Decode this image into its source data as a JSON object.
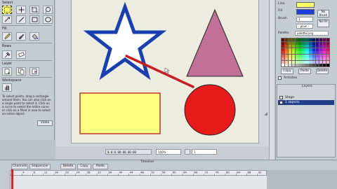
{
  "left_panel": {
    "sections": {
      "select": "Select",
      "fill": "Fill",
      "rows": "Rows",
      "layer": "Layer",
      "workspace": "Workspace"
    },
    "workspace_description": "To select points, drag a rectangle around them. You can also click on a single point to select it. Click on a curve to select the entire curve or click on a filled in area to select an entire object.",
    "video_button": "Video",
    "tools": [
      "select-tool",
      "move-tool",
      "crop-tool",
      "lasso-tool",
      "pen-tool",
      "line-tool",
      "rect-tool",
      "ellipse-tool",
      "pencil-tool",
      "brush-tool",
      "fill-tool",
      "eyedropper-tool",
      "eraser-tool",
      "layer-new",
      "layer-copy",
      "layer-delete",
      "hand-tool"
    ]
  },
  "stage": {
    "shapes": [
      {
        "kind": "star",
        "fill": "#ffffff",
        "stroke": "#1a3fb0"
      },
      {
        "kind": "triangle",
        "fill": "#c27098",
        "stroke": "#222222"
      },
      {
        "kind": "rectangle",
        "fill": "#ffff80",
        "stroke": "#c0392b"
      },
      {
        "kind": "circle",
        "fill": "#e81b1b",
        "stroke": "#222222"
      },
      {
        "kind": "line",
        "stroke": "#c81e1e"
      }
    ],
    "coords_readout": "0.0:0.00:00.00:00",
    "zoom": "100%",
    "page": "1"
  },
  "right_panel": {
    "stroke_color": "#ffff66",
    "fill_color": "#1a3fdb",
    "no_brush": "No Brush",
    "no_fill": "No Fill",
    "line_label": "Line",
    "fill_label": "Fill",
    "brush_label": "Brush",
    "width_value": "1",
    "style_value": "- plain -",
    "palette_label": "Palette",
    "palette_name": "palette.png",
    "palette_buttons": [
      "Copy",
      "Paste",
      "Delete"
    ],
    "antialias_label": "Antialias",
    "layers_title": "Layers",
    "layers": [
      {
        "name": "Stage",
        "selected": false
      },
      {
        "name": "1 objects",
        "selected": true
      }
    ]
  },
  "timeline": {
    "title": "Timeline",
    "tabs": [
      "Channels",
      "Sequencer",
      "Delete",
      "Copy",
      "Paste"
    ],
    "frame_labels": [
      "0",
      "4",
      "8",
      "12",
      "16",
      "20",
      "24",
      "28",
      "32",
      "36",
      "40",
      "44",
      "48",
      "52",
      "56",
      "60",
      "64",
      "68",
      "72",
      "76",
      "80",
      "84",
      "88",
      "92"
    ]
  }
}
